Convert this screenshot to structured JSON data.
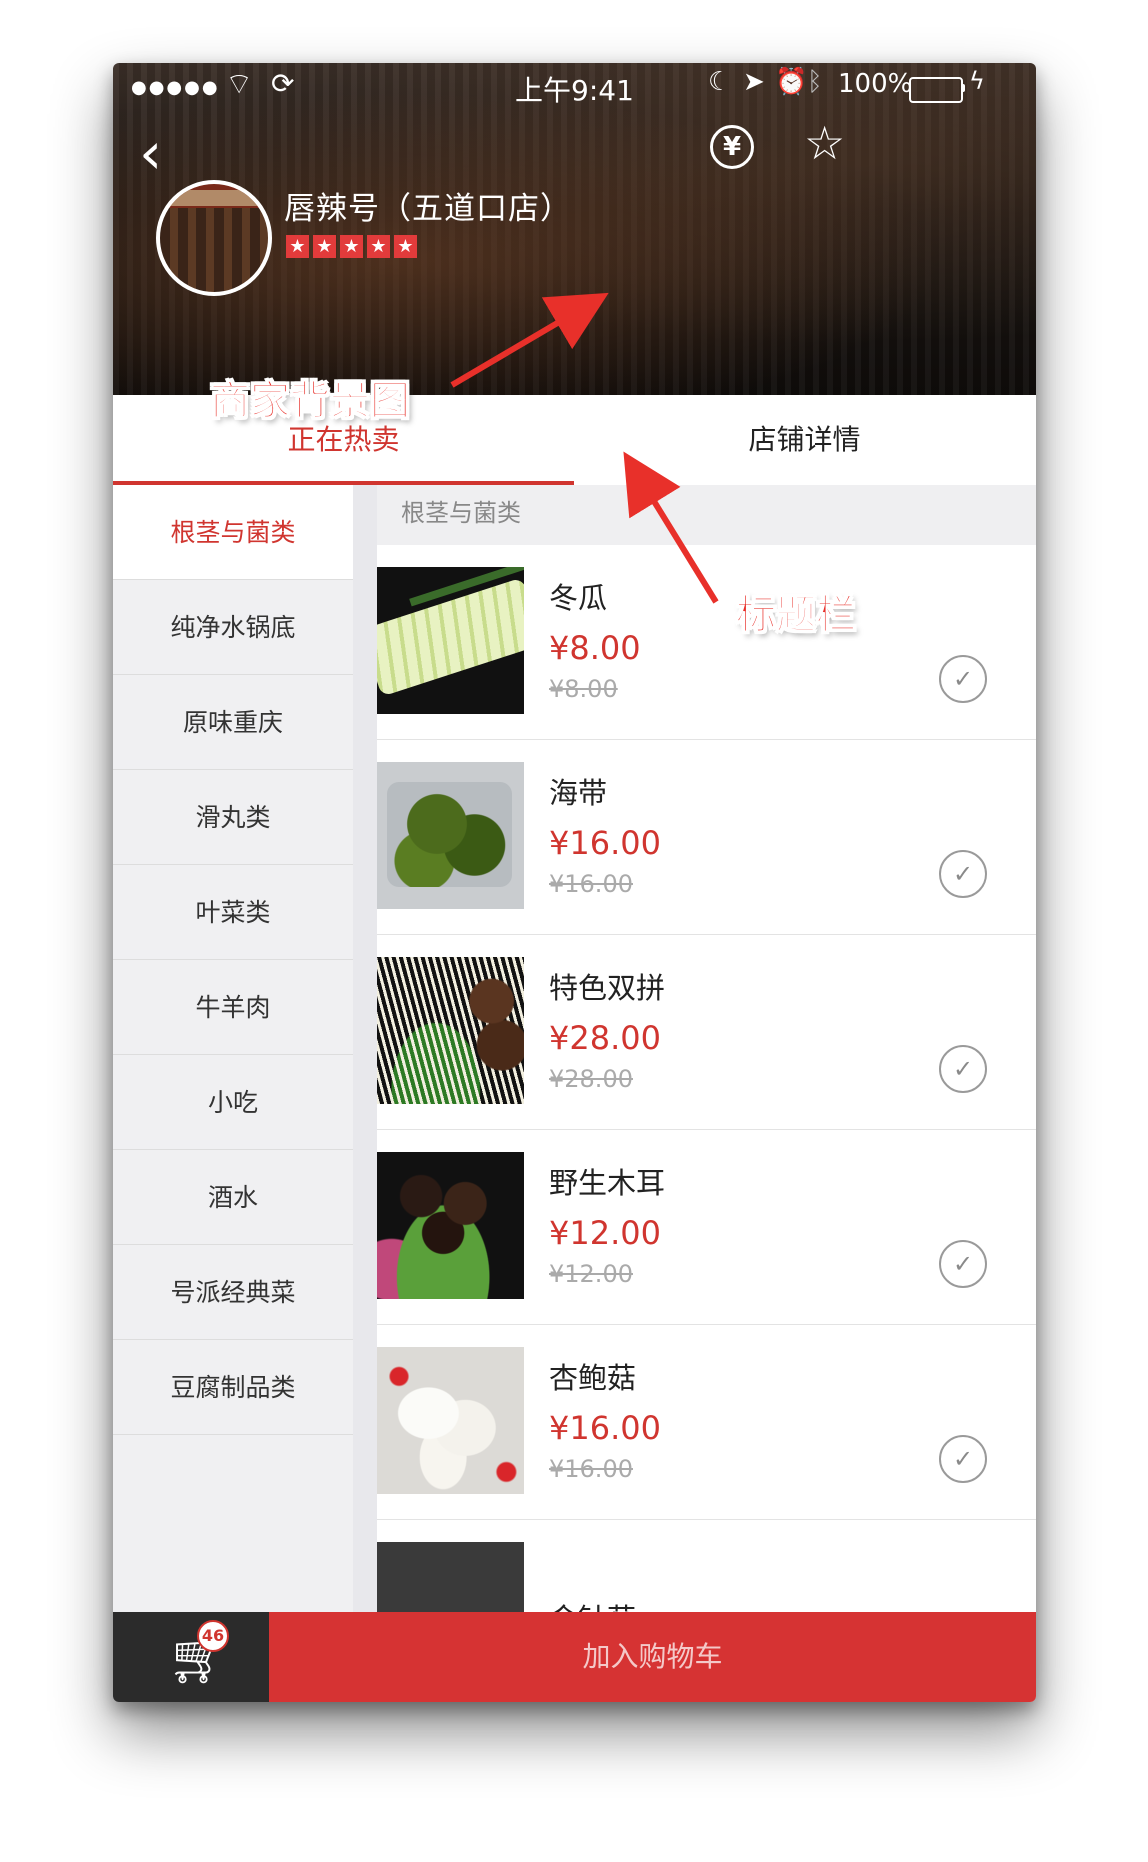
{
  "status_bar": {
    "signal": "●●●●●",
    "time": "上午9:41",
    "battery_percent": "100%",
    "battery_level": 1.0
  },
  "header": {
    "shop_name": "唇辣号（五道口店）",
    "rating": 5,
    "rating_star": "★",
    "yen_symbol": "¥",
    "back_glyph": "‹",
    "favorite_glyph": "☆"
  },
  "tabs": [
    {
      "label": "正在热卖",
      "active": true
    },
    {
      "label": "店铺详情",
      "active": false
    }
  ],
  "sidebar": {
    "items": [
      {
        "label": "根茎与菌类",
        "active": true
      },
      {
        "label": "纯净水锅底"
      },
      {
        "label": "原味重庆"
      },
      {
        "label": "滑丸类"
      },
      {
        "label": "叶菜类"
      },
      {
        "label": "牛羊肉"
      },
      {
        "label": "小吃"
      },
      {
        "label": "酒水"
      },
      {
        "label": "号派经典菜"
      },
      {
        "label": "豆腐制品类"
      }
    ]
  },
  "section": {
    "title": "根茎与菌类"
  },
  "products": [
    {
      "name": "冬瓜",
      "price": "¥8.00",
      "original_price": "¥8.00"
    },
    {
      "name": "海带",
      "price": "¥16.00",
      "original_price": "¥16.00"
    },
    {
      "name": "特色双拼",
      "price": "¥28.00",
      "original_price": "¥28.00"
    },
    {
      "name": "野生木耳",
      "price": "¥12.00",
      "original_price": "¥12.00"
    },
    {
      "name": "杏鲍菇",
      "price": "¥16.00",
      "original_price": "¥16.00"
    },
    {
      "name": "金针菇"
    }
  ],
  "cart": {
    "count": "46",
    "add_label": "加入购物车"
  },
  "annotations": {
    "background_label": "商家背景图",
    "title_bar_label": "标题栏"
  },
  "colors": {
    "accent": "#d0352f",
    "cart_bar": "#d63333",
    "cart_area": "#2b2b2b",
    "battery": "#4cd964"
  }
}
